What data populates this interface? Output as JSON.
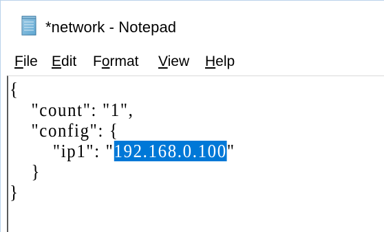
{
  "window": {
    "title": "*network - Notepad",
    "app_icon": "notepad-icon"
  },
  "menu": {
    "file": {
      "accel": "F",
      "rest": "ile"
    },
    "edit": {
      "accel": "E",
      "rest": "dit"
    },
    "format": {
      "pre": "F",
      "accel": "o",
      "rest": "rmat"
    },
    "view": {
      "accel": "V",
      "rest": "iew"
    },
    "help": {
      "accel": "H",
      "rest": "elp"
    }
  },
  "editor": {
    "lines": {
      "l1": "{",
      "l2": "    \"count\": \"1\",",
      "l3": "    \"config\": {",
      "l4_before": "        \"ip1\": \"",
      "l4_selected": "192.168.0.100",
      "l4_after": "\"",
      "l5": "    }",
      "l6": "}"
    },
    "selection_color": "#0078d7"
  }
}
